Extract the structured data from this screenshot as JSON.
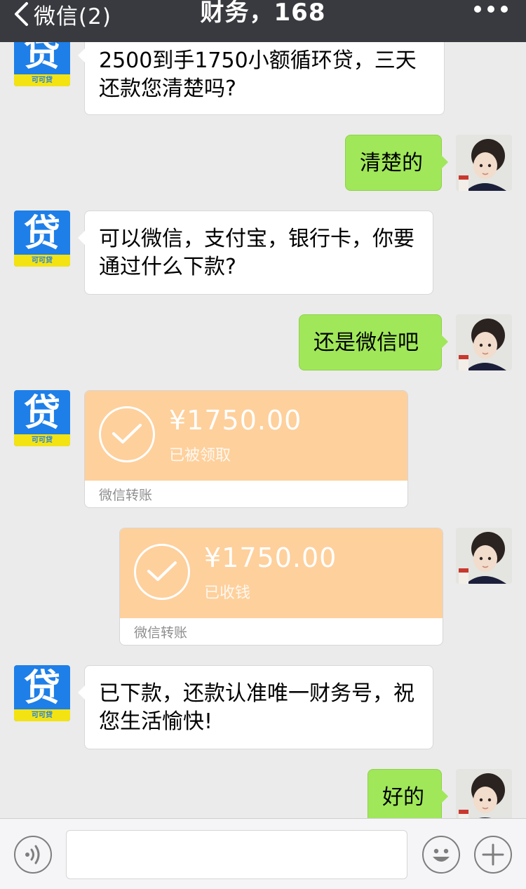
{
  "nav": {
    "back_label": "微信(2)",
    "title": "财务，168"
  },
  "loan_avatar": {
    "glyph": "贷",
    "caption": "可可贷"
  },
  "messages": {
    "m1": "2500到手1750小额循环贷，三天还款您清楚吗?",
    "m2": "清楚的",
    "m3": "可以微信，支付宝，银行卡，你要通过什么下款?",
    "m4": "还是微信吧",
    "m7": "已下款，还款认准唯一财务号，祝您生活愉快!",
    "m8": "好的"
  },
  "transfers": {
    "t1": {
      "amount": "¥1750.00",
      "status": "已被领取",
      "footer": "微信转账"
    },
    "t2": {
      "amount": "¥1750.00",
      "status": "已收钱",
      "footer": "微信转账"
    }
  },
  "input": {
    "value": ""
  },
  "icons": {
    "back": "chevron-left-icon",
    "more": "more-dots-icon",
    "voice": "voice-icon",
    "emoji": "emoji-icon",
    "add": "plus-icon"
  },
  "colors": {
    "navbar": "#393a3f",
    "chat_bg": "#ebebeb",
    "my_bubble": "#a0e75a",
    "transfer": "#fed09c",
    "loan_blue": "#1e7fe8",
    "loan_yellow": "#f4e312"
  }
}
